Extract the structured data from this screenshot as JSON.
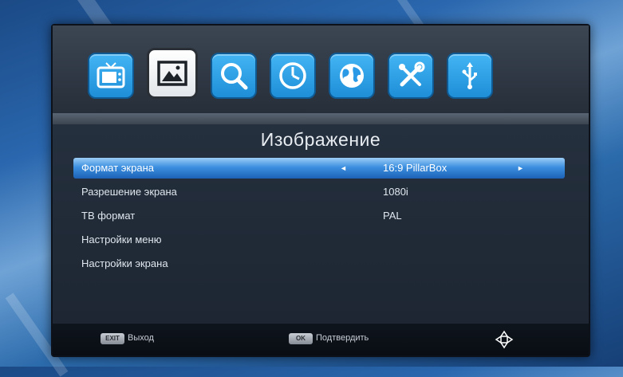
{
  "menu": {
    "tabs": [
      {
        "icon": "tv-icon",
        "active": false
      },
      {
        "icon": "picture-icon",
        "active": true
      },
      {
        "icon": "search-icon",
        "active": false
      },
      {
        "icon": "clock-icon",
        "active": false
      },
      {
        "icon": "globe-icon",
        "active": false
      },
      {
        "icon": "tools-icon",
        "active": false
      },
      {
        "icon": "usb-icon",
        "active": false
      }
    ],
    "accent_color": "#2b9ae6"
  },
  "screen": {
    "title": "Изображение",
    "settings": [
      {
        "label": "Формат экрана",
        "value": "16:9 PillarBox",
        "selected": true
      },
      {
        "label": "Разрешение экрана",
        "value": "1080i",
        "selected": false
      },
      {
        "label": "ТВ формат",
        "value": "PAL",
        "selected": false
      },
      {
        "label": "Настройки меню",
        "value": "",
        "selected": false
      },
      {
        "label": "Настройки экрана",
        "value": "",
        "selected": false
      }
    ]
  },
  "footer": {
    "exit_key": "EXIT",
    "exit_label": "Выход",
    "ok_key": "OK",
    "ok_label": "Подтвердить",
    "nav_icon": "navigation-arrows-icon"
  }
}
